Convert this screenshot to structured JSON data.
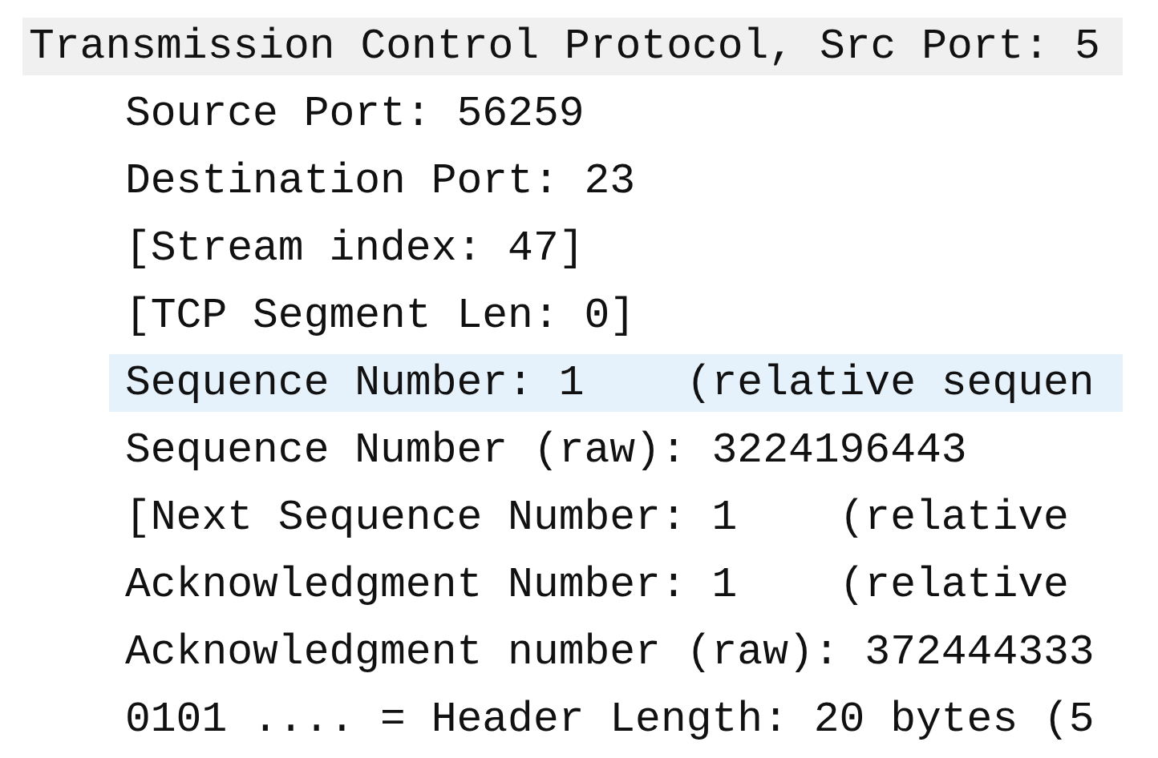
{
  "tree": {
    "label": "Transmission Control Protocol, Src Port: 5",
    "children": [
      {
        "label": "Source Port: 56259",
        "selected": false
      },
      {
        "label": "Destination Port: 23",
        "selected": false
      },
      {
        "label": "[Stream index: 47]",
        "selected": false
      },
      {
        "label": "[TCP Segment Len: 0]",
        "selected": false
      },
      {
        "label": "Sequence Number: 1    (relative sequen",
        "selected": true
      },
      {
        "label": "Sequence Number (raw): 3224196443",
        "selected": false
      },
      {
        "label": "[Next Sequence Number: 1    (relative",
        "selected": false
      },
      {
        "label": "Acknowledgment Number: 1    (relative",
        "selected": false
      },
      {
        "label": "Acknowledgment number (raw): 372444333",
        "selected": false
      },
      {
        "label": "0101 .... = Header Length: 20 bytes (5",
        "selected": false
      }
    ]
  }
}
